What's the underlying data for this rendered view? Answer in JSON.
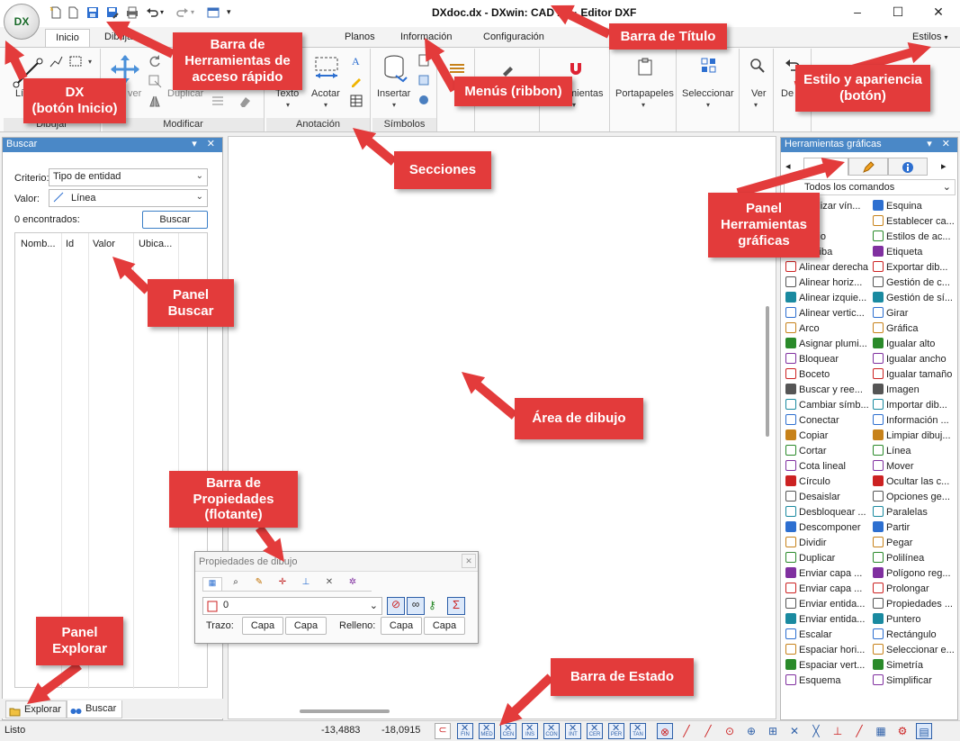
{
  "titlebar": {
    "title": "DXdoc.dx - DXwin: CAD 2D · Editor DXF",
    "dx_label": "DX",
    "minimize": "–",
    "maximize": "☐",
    "close": "✕"
  },
  "ribbon": {
    "tabs": [
      "Inicio",
      "Dibujar",
      "Planos",
      "Información",
      "Configuración"
    ],
    "styles_label": "Estilos",
    "groups": [
      "Dibujar",
      "Modificar",
      "Anotación",
      "Símbolos"
    ],
    "buttons": {
      "linea": "Lí",
      "mover": "ver",
      "duplicar": "Duplicar",
      "texto": "Texto",
      "acotar": "Acotar",
      "insertar": "Insertar",
      "herramientas": "mientas",
      "portapapeles": "Portapapeles",
      "seleccionar": "Seleccionar",
      "ver": "Ver",
      "deshacer": "De"
    }
  },
  "search_panel": {
    "title": "Buscar",
    "criterio_label": "Criterio:",
    "criterio_value": "Tipo de entidad",
    "valor_label": "Valor:",
    "valor_value": "Línea",
    "found": "0 encontrados:",
    "search_button": "Buscar",
    "columns": [
      "Nomb...",
      "Id",
      "Valor",
      "Ubica..."
    ],
    "tabs": [
      "Explorar",
      "Buscar"
    ]
  },
  "tools_panel": {
    "title": "Herramientas gráficas",
    "filter": "Todos los comandos",
    "left_commands": [
      "...ualizar vín...",
      "",
      "...bajo",
      "...arriba",
      "Alinear derecha",
      "Alinear horiz...",
      "Alinear izquie...",
      "Alinear vertic...",
      "Arco",
      "Asignar plumi...",
      "Bloquear",
      "Boceto",
      "Buscar y ree...",
      "Cambiar símb...",
      "Conectar",
      "Copiar",
      "Cortar",
      "Cota lineal",
      "Círculo",
      "Desaislar",
      "Desbloquear ...",
      "Descomponer",
      "Dividir",
      "Duplicar",
      "Enviar capa ...",
      "Enviar capa ...",
      "Enviar entida...",
      "Enviar entida...",
      "Escalar",
      "Espaciar hori...",
      "Espaciar vert...",
      "Esquema"
    ],
    "right_commands": [
      "Esquina",
      "Establecer ca...",
      "Estilos de ac...",
      "Etiqueta",
      "Exportar dib...",
      "Gestión de c...",
      "Gestión de sí...",
      "Girar",
      "Gráfica",
      "Igualar alto",
      "Igualar ancho",
      "Igualar tamaño",
      "Imagen",
      "Importar dib...",
      "Información ...",
      "Limpiar dibuj...",
      "Línea",
      "Mover",
      "Ocultar las c...",
      "Opciones ge...",
      "Paralelas",
      "Partir",
      "Pegar",
      "Polilínea",
      "Polígono reg...",
      "Prolongar",
      "Propiedades ...",
      "Puntero",
      "Rectángulo",
      "Seleccionar e...",
      "Simetría",
      "Simplificar"
    ]
  },
  "properties": {
    "title": "Propiedades de dibujo",
    "layer_value": "0",
    "trazo_label": "Trazo:",
    "relleno_label": "Relleno:",
    "capa": "Capa"
  },
  "status": {
    "text": "Listo",
    "x": "-13,4883",
    "y": "-18,0915",
    "snaps": [
      "FIN",
      "MED",
      "CEN",
      "INS",
      "CON",
      "INT",
      "CER",
      "PER",
      "TAN"
    ]
  },
  "callouts": {
    "dx": "DX\n(botón Inicio)",
    "qat": "Barra de\nHerramientas de\nacceso rápido",
    "titlebar": "Barra de Título",
    "ribbon": "Menús (ribbon)",
    "style": "Estilo y apariencia\n(botón)",
    "sections": "Secciones",
    "tools_panel": "Panel\nHerramientas\ngráficas",
    "search_panel": "Panel\nBuscar",
    "drawing_area": "Área de dibujo",
    "props_bar": "Barra de\nPropiedades\n(flotante)",
    "explore_panel": "Panel\nExplorar",
    "status_bar": "Barra de Estado"
  }
}
